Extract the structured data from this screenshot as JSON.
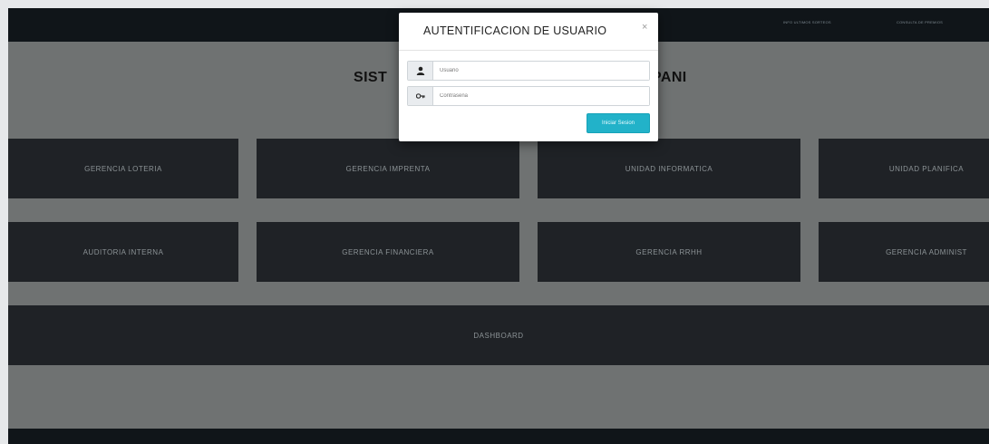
{
  "topbar": {
    "nav_items": [
      "INFO ULTIMOS SORTEOS",
      "CONSULTA DE PREMIOS"
    ]
  },
  "page": {
    "title_left": "SIST",
    "title_right": "PANI"
  },
  "tiles": [
    "GERENCIA LOTERIA",
    "GERENCIA IMPRENTA",
    "UNIDAD INFORMATICA",
    "UNIDAD PLANIFICA",
    "AUDITORIA INTERNA",
    "GERENCIA FINANCIERA",
    "GERENCIA RRHH",
    "GERENCIA ADMINIST",
    "DASHBOARD"
  ],
  "modal": {
    "title": "AUTENTIFICACION DE USUARIO",
    "close_symbol": "×",
    "username_placeholder": "Usuario",
    "password_placeholder": "Contraseña",
    "submit_label": "Iniciar Sesion",
    "icons": [
      "user-icon",
      "key-icon"
    ]
  },
  "colors": {
    "overlay_bg": "#6f7272",
    "topbar": "#101519",
    "tile": "#1f2226",
    "button": "#22b2c9"
  }
}
